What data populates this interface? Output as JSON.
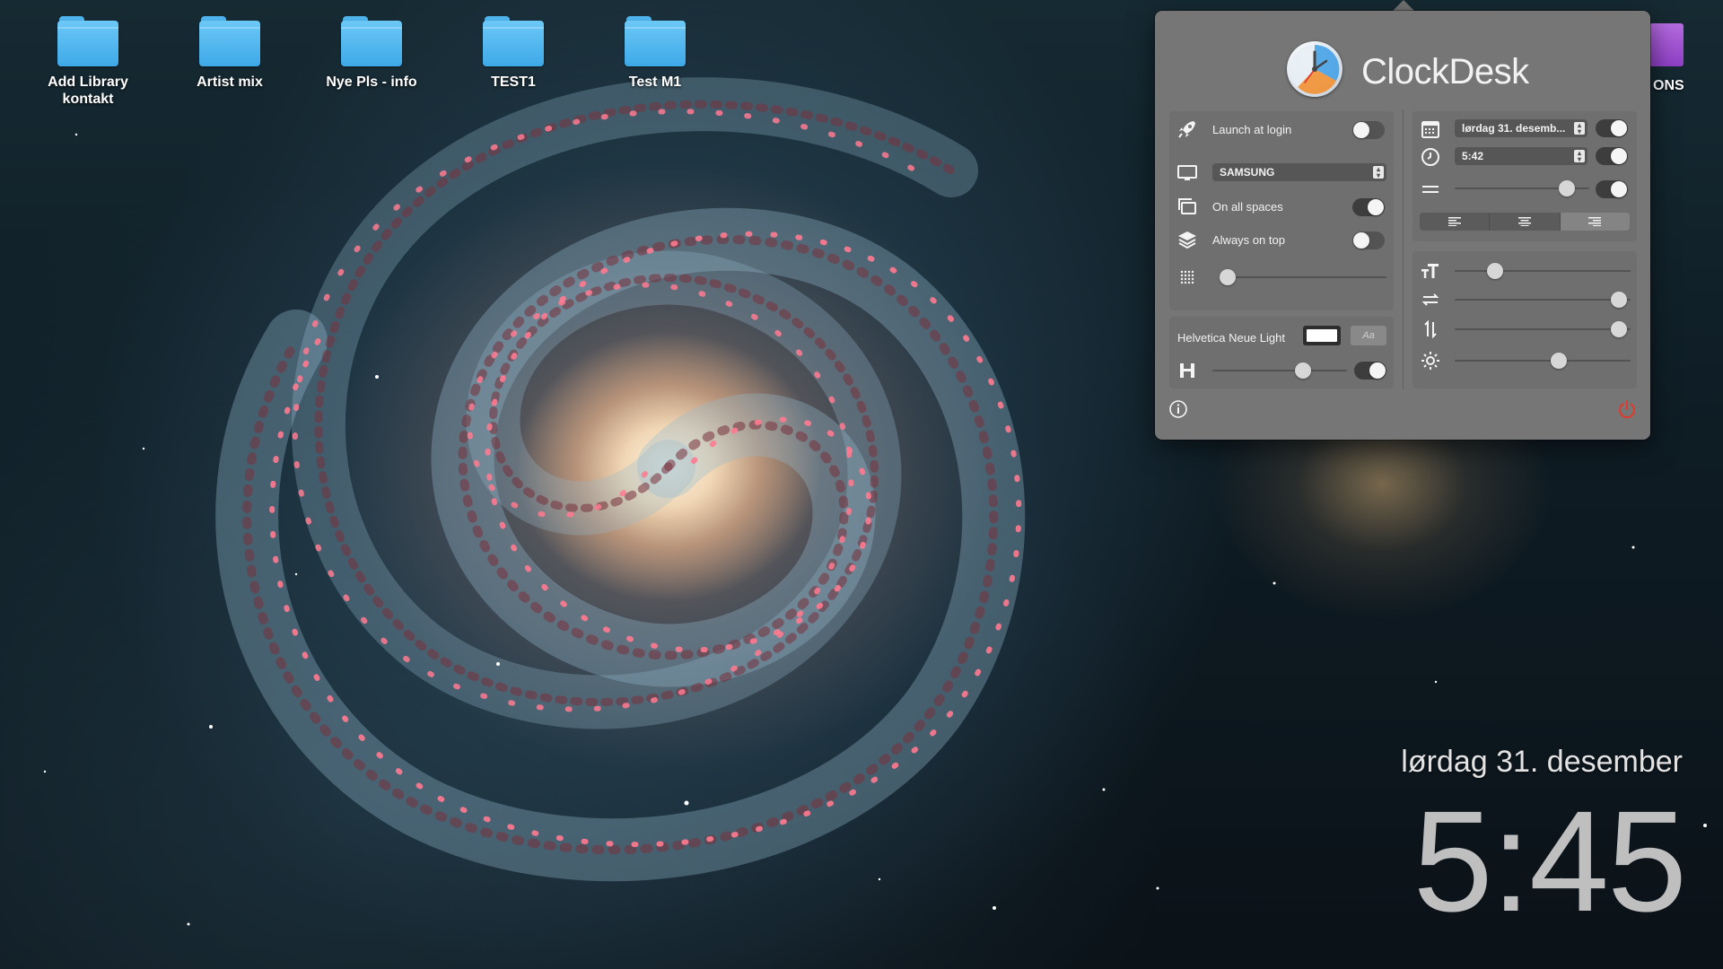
{
  "desktop": {
    "icons": [
      {
        "label_line1": "Add Library",
        "label_line2": "kontakt",
        "icon": "folder-icon"
      },
      {
        "label_line1": "Artist mix",
        "label_line2": "",
        "icon": "folder-icon"
      },
      {
        "label_line1": "Nye Pls - info",
        "label_line2": "",
        "icon": "folder-icon"
      },
      {
        "label_line1": "TEST1",
        "label_line2": "",
        "icon": "folder-icon"
      },
      {
        "label_line1": "Test M1",
        "label_line2": "",
        "icon": "folder-icon"
      }
    ],
    "partial_icon_label": "ONS",
    "clock_date": "lørdag 31. desember",
    "clock_time": "5:45"
  },
  "clockdesk": {
    "title": "ClockDesk",
    "left": {
      "launch_at_login": {
        "label": "Launch at login",
        "on": false
      },
      "display": {
        "value": "SAMSUNG"
      },
      "on_all_spaces": {
        "label": "On all spaces",
        "on": true
      },
      "always_on_top": {
        "label": "Always on top",
        "on": false
      },
      "opacity": {
        "level": 0.0
      },
      "font": {
        "name": "Helvetica Neue Light",
        "color": "#ffffff",
        "font_button": "Aa"
      },
      "size": {
        "level": 0.7,
        "toggle_on": true
      }
    },
    "right": {
      "date_format": {
        "value": "lørdag 31. desemb...",
        "toggle_on": true
      },
      "time_format": {
        "value": "5:42",
        "toggle_on": true
      },
      "spacing": {
        "level": 0.88,
        "toggle_on": true
      },
      "alignment": {
        "options": [
          "left",
          "center",
          "right"
        ],
        "selected": "right"
      },
      "text_size": {
        "level": 0.2
      },
      "horizontal_position": {
        "level": 0.98
      },
      "vertical_position": {
        "level": 0.98
      },
      "brightness": {
        "level": 0.6
      }
    },
    "footer": {
      "info_icon": "info-icon",
      "quit_icon": "power-icon",
      "quit_color": "#e03a2f"
    }
  }
}
